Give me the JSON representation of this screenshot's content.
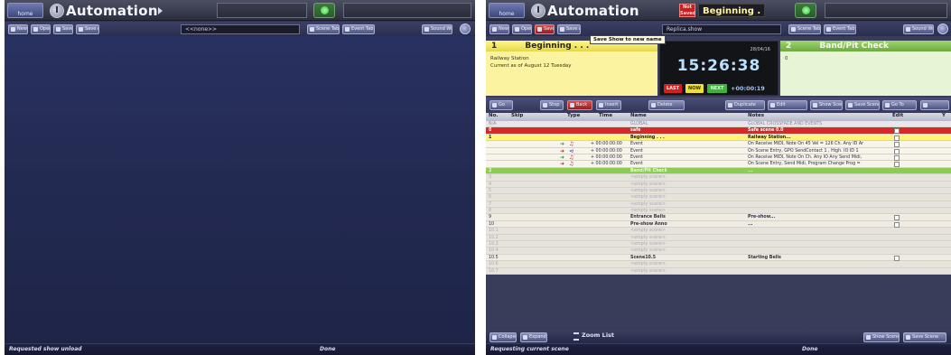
{
  "left": {
    "home_label": "home",
    "title": "Automation",
    "show_field": "<<none>>",
    "toolbar_buttons": [
      "New",
      "Open",
      "Save",
      "Save As"
    ],
    "right_buttons": [
      "Scene Tab",
      "Event Tab",
      "Sound Wnd"
    ],
    "status_left": "Requested show unload",
    "status_right": "Done"
  },
  "right": {
    "home_label": "home",
    "title": "Automation",
    "not_saved": "Not Saved",
    "scene_title": "Beginning .",
    "show_field": "Replica.show",
    "tooltip": "Save Show to new name",
    "toolbar_buttons": [
      "New",
      "Open",
      "Save",
      "Save As"
    ],
    "right_buttons": [
      "Scene Tab",
      "Event Tab",
      "Sound Wnd"
    ],
    "current_scene": {
      "number": "1",
      "name": "Beginning . . .",
      "line1": "Railway Station",
      "line2": "Current as of August 12 Tuesday"
    },
    "next_scene": {
      "number": "2",
      "name": "Band/Pit Check",
      "line1": "0"
    },
    "clock": {
      "date": "28/04/16",
      "time": "15:26:38",
      "last": "LAST",
      "now": "NOW",
      "next": "NEXT",
      "elapsed": "+00:00:19"
    },
    "toolbar2_buttons": [
      "Go",
      "Stop",
      "Back",
      "Insert",
      "Delete",
      "Duplicate",
      "Edit",
      "Show Scene",
      "Save Scene",
      "Go To"
    ],
    "table_headers": {
      "no": "No.",
      "skip": "Skip",
      "type": "Type",
      "time": "Time",
      "name": "Name",
      "notes": "Notes",
      "edit": "Edit",
      "filter": "Y"
    },
    "rows": [
      {
        "style": "global",
        "no": "N/A",
        "icon": "",
        "time": "",
        "name": "GLOBAL",
        "notes": "GLOBAL CROSSFADE AND EVENTS",
        "check": false
      },
      {
        "style": "safe",
        "no": "0",
        "icon": "",
        "time": "",
        "name": "safe",
        "notes": "Safe scene 0.0",
        "check": true
      },
      {
        "style": "scene-cur",
        "no": "1",
        "icon": "",
        "time": "",
        "name": "Beginning . . .",
        "notes": "Railway Station...",
        "check": true
      },
      {
        "style": "event",
        "no": "",
        "icon": "in-music",
        "time": "+ 00:00:00:00",
        "name": "Event",
        "notes": "On Receive MIDI, Note On 45 Vel = 126 Ch. Any ID Ar",
        "check": true
      },
      {
        "style": "event",
        "no": "",
        "icon": "out-gpo",
        "time": "+ 00:00:00:00",
        "name": "Event",
        "notes": "On Scene Entry, GPO SendContact 1 , High. IO ID 1",
        "check": true
      },
      {
        "style": "event",
        "no": "",
        "icon": "in-music",
        "time": "+ 00:00:00:00",
        "name": "Event",
        "notes": "On Receive MIDI, Note On Ch. Any IO Any Send Midi,",
        "check": true
      },
      {
        "style": "event",
        "no": "",
        "icon": "out-music",
        "time": "+ 00:00:00:00",
        "name": "Event",
        "notes": "On Scene Entry, Send Midi, Program Change Prog =",
        "check": true
      },
      {
        "style": "scene-next",
        "no": "2",
        "icon": "",
        "time": "",
        "name": "Band/Pit Check",
        "notes": "...",
        "check": false
      },
      {
        "style": "empty",
        "no": "3",
        "icon": "",
        "time": "",
        "name": "<empty scene>",
        "notes": "",
        "check": false
      },
      {
        "style": "empty",
        "no": "4",
        "icon": "",
        "time": "",
        "name": "<empty scene>",
        "notes": "",
        "check": false
      },
      {
        "style": "empty",
        "no": "5",
        "icon": "",
        "time": "",
        "name": "<empty scene>",
        "notes": "",
        "check": false
      },
      {
        "style": "empty",
        "no": "6",
        "icon": "",
        "time": "",
        "name": "<empty scene>",
        "notes": "",
        "check": false
      },
      {
        "style": "empty",
        "no": "7",
        "icon": "",
        "time": "",
        "name": "<empty scene>",
        "notes": "",
        "check": false
      },
      {
        "style": "empty",
        "no": "8",
        "icon": "",
        "time": "",
        "name": "<empty scene>",
        "notes": "",
        "check": false
      },
      {
        "style": "plain",
        "no": "9",
        "icon": "",
        "time": "",
        "name": "Entrance Bells",
        "notes": "Pre-show...",
        "check": true
      },
      {
        "style": "plain",
        "no": "10",
        "icon": "",
        "time": "",
        "name": "Pre-show Anno",
        "notes": "...",
        "check": true
      },
      {
        "style": "empty",
        "no": "10.1",
        "icon": "",
        "time": "",
        "name": "<empty scene>",
        "notes": "",
        "check": false
      },
      {
        "style": "empty",
        "no": "10.2",
        "icon": "",
        "time": "",
        "name": "<empty scene>",
        "notes": "",
        "check": false
      },
      {
        "style": "empty",
        "no": "10.3",
        "icon": "",
        "time": "",
        "name": "<empty scene>",
        "notes": "",
        "check": false
      },
      {
        "style": "empty",
        "no": "10.4",
        "icon": "",
        "time": "",
        "name": "<empty scene>",
        "notes": "",
        "check": false
      },
      {
        "style": "plain",
        "no": "10.5",
        "icon": "",
        "time": "",
        "name": "Scene10.5",
        "notes": "Starting Bells",
        "check": true
      },
      {
        "style": "empty",
        "no": "10.6",
        "icon": "",
        "time": "",
        "name": "<empty scene>",
        "notes": "",
        "check": false
      },
      {
        "style": "empty",
        "no": "10.7",
        "icon": "",
        "time": "",
        "name": "<empty scene>",
        "notes": "",
        "check": false
      }
    ],
    "bottom_buttons": [
      "Collapse",
      "Expand"
    ],
    "zoom_label": "Zoom List",
    "bottom_right_buttons": [
      "Show Scene",
      "Save Scene"
    ],
    "status_left": "Requesting current scene",
    "status_right": "Done"
  }
}
